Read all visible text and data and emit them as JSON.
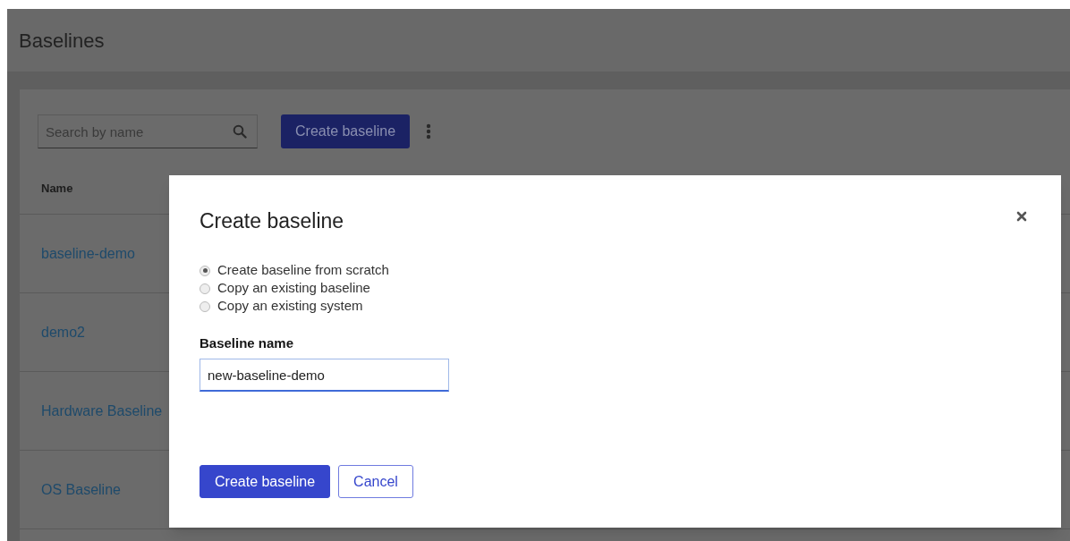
{
  "page": {
    "title": "Baselines"
  },
  "toolbar": {
    "search": {
      "placeholder": "Search by name"
    },
    "create_button": "Create baseline"
  },
  "table": {
    "columns": [
      "Name"
    ],
    "rows": [
      {
        "name": "baseline-demo"
      },
      {
        "name": "demo2"
      },
      {
        "name": "Hardware Baseline"
      },
      {
        "name": "OS Baseline"
      }
    ]
  },
  "dialog": {
    "title": "Create baseline",
    "options": [
      {
        "label": "Create baseline from scratch",
        "selected": true
      },
      {
        "label": "Copy an existing baseline",
        "selected": false
      },
      {
        "label": "Copy an existing system",
        "selected": false
      }
    ],
    "field": {
      "label": "Baseline name",
      "value": "new-baseline-demo"
    },
    "buttons": [
      {
        "label": "Create baseline",
        "kind": "primary"
      },
      {
        "label": "Cancel",
        "kind": "secondary"
      }
    ]
  }
}
